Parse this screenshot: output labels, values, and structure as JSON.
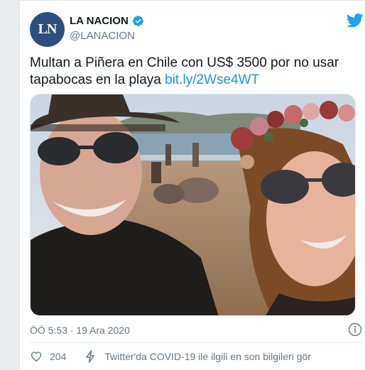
{
  "account": {
    "avatar_text": "LN",
    "name": "LA NACION",
    "handle": "@LANACION",
    "verified": true
  },
  "tweet": {
    "text": "Multan a Piñera en Chile con US$ 3500 por no usar tapabocas en la playa ",
    "link": "bit.ly/2Wse4WT",
    "timestamp": "ÖÖ 5:53 · 19 Ara 2020"
  },
  "footer": {
    "likes": "204",
    "covid_info": "Twitter'da COVID-19 ile ilgili en son bilgileri gör"
  },
  "icons": {
    "brand": "twitter-bird-icon",
    "verified": "verified-badge-icon",
    "info": "info-icon",
    "like": "heart-icon",
    "covid": "lightning-bolt-icon"
  },
  "colors": {
    "accent": "#1da1f2",
    "link": "#1b95e0",
    "secondary_text": "#657786",
    "avatar_bg": "#2b4f7e"
  }
}
